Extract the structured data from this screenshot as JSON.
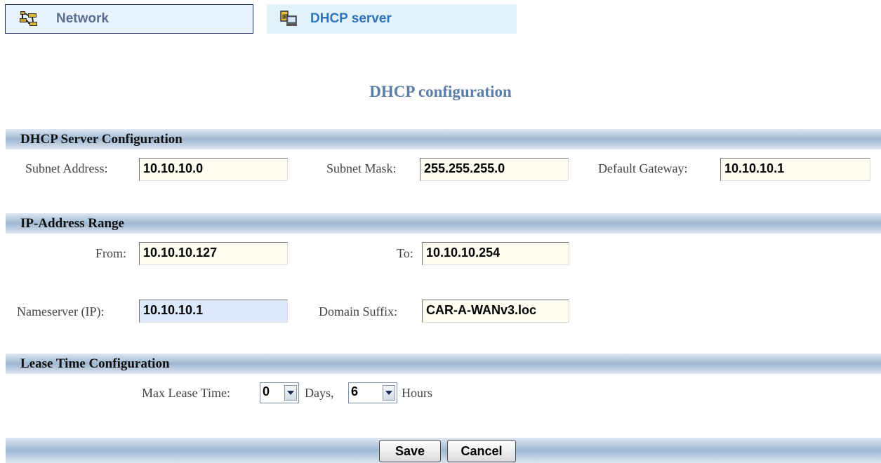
{
  "tabs": {
    "network": {
      "label": "Network",
      "icon": "network-icon"
    },
    "dhcp": {
      "label": "DHCP server",
      "icon": "dhcp-server-icon"
    }
  },
  "page_title": "DHCP configuration",
  "sections": {
    "server": {
      "title": "DHCP Server Configuration",
      "subnet_address_label": "Subnet Address:",
      "subnet_address_value": "10.10.10.0",
      "subnet_mask_label": "Subnet Mask:",
      "subnet_mask_value": "255.255.255.0",
      "default_gateway_label": "Default Gateway:",
      "default_gateway_value": "10.10.10.1"
    },
    "range": {
      "title": "IP-Address Range",
      "from_label": "From:",
      "from_value": "10.10.10.127",
      "to_label": "To:",
      "to_value": "10.10.10.254",
      "nameserver_label": "Nameserver (IP):",
      "nameserver_value": "10.10.10.1",
      "domain_suffix_label": "Domain Suffix:",
      "domain_suffix_value": "CAR-A-WANv3.loc"
    },
    "lease": {
      "title": "Lease Time Configuration",
      "max_lease_label": "Max Lease Time:",
      "days_value": "0",
      "days_label": "Days,",
      "hours_value": "6",
      "hours_label": "Hours"
    }
  },
  "buttons": {
    "save": "Save",
    "cancel": "Cancel"
  },
  "colors": {
    "title": "#5a7ea8",
    "tab_active_text": "#2f73b8",
    "input_background": "#fefdf0",
    "input_highlight": "#dbe9fa"
  }
}
